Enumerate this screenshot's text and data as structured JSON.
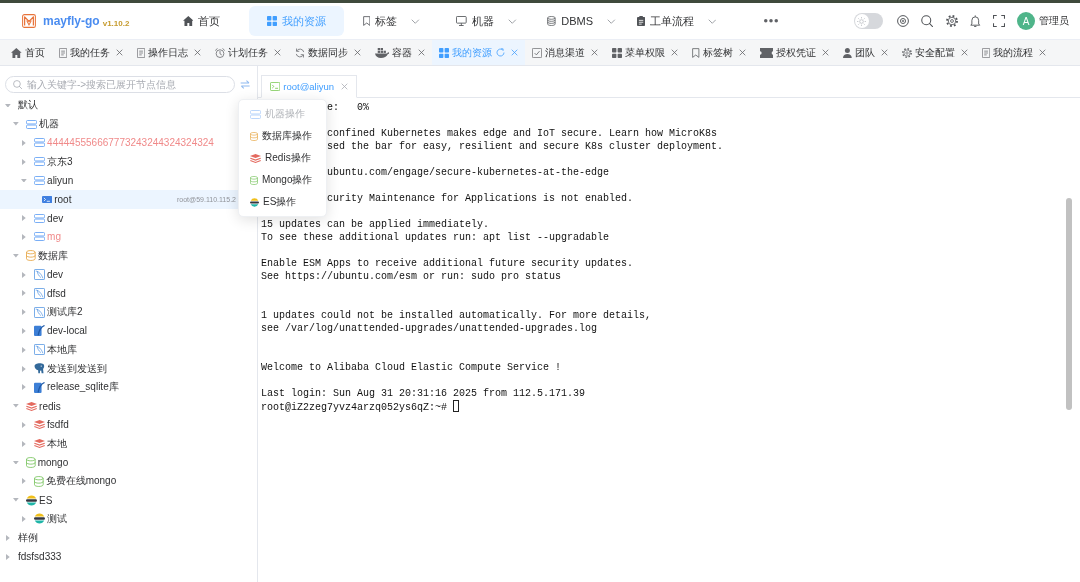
{
  "brand": {
    "name": "mayfly-go",
    "version": "v1.10.2"
  },
  "header": {
    "nav": [
      {
        "label": "首页",
        "selected": false,
        "dropdown": false
      },
      {
        "label": "我的资源",
        "selected": true,
        "dropdown": false
      },
      {
        "label": "标签",
        "selected": false,
        "dropdown": true
      },
      {
        "label": "机器",
        "selected": false,
        "dropdown": true
      },
      {
        "label": "DBMS",
        "selected": false,
        "dropdown": true
      },
      {
        "label": "工单流程",
        "selected": false,
        "dropdown": true
      }
    ],
    "theme_switch": {
      "on": false
    },
    "user": {
      "avatar": "A",
      "name": "管理员"
    }
  },
  "page_tabs": [
    {
      "label": "首页",
      "selected": false,
      "closable": false
    },
    {
      "label": "我的任务",
      "selected": false,
      "closable": true
    },
    {
      "label": "操作日志",
      "selected": false,
      "closable": true
    },
    {
      "label": "计划任务",
      "selected": false,
      "closable": true
    },
    {
      "label": "数据同步",
      "selected": false,
      "closable": true
    },
    {
      "label": "容器",
      "selected": false,
      "closable": true
    },
    {
      "label": "我的资源",
      "selected": true,
      "closable": true
    },
    {
      "label": "消息渠道",
      "selected": false,
      "closable": true
    },
    {
      "label": "菜单权限",
      "selected": false,
      "closable": true
    },
    {
      "label": "标签树",
      "selected": false,
      "closable": true
    },
    {
      "label": "授权凭证",
      "selected": false,
      "closable": true
    },
    {
      "label": "团队",
      "selected": false,
      "closable": true
    },
    {
      "label": "安全配置",
      "selected": false,
      "closable": true
    },
    {
      "label": "我的流程",
      "selected": false,
      "closable": true
    }
  ],
  "resource_tree": {
    "search": {
      "placeholder": "输入关键字->搜索已展开节点信息"
    },
    "nodes": [
      {
        "label": "默认",
        "expanded": true,
        "selected": false,
        "children": [
          {
            "label": "机器",
            "kind": "server",
            "expanded": true,
            "selected": false,
            "children": [
              {
                "label": "444445556667773243244324324324",
                "kind": "server",
                "expanded": false,
                "selected": false,
                "color": "#f08a8a"
              },
              {
                "label": "京东3",
                "kind": "server",
                "expanded": false,
                "selected": false
              },
              {
                "label": "aliyun",
                "kind": "server",
                "expanded": true,
                "selected": false,
                "children": [
                  {
                    "label": "root",
                    "kind": "account",
                    "selected": true,
                    "detail": "root@59.110.115.2"
                  }
                ]
              },
              {
                "label": "dev",
                "kind": "server",
                "expanded": false,
                "selected": false
              },
              {
                "label": "mg",
                "kind": "server",
                "expanded": false,
                "selected": false,
                "color": "#f08a8a"
              }
            ]
          },
          {
            "label": "数据库",
            "kind": "database",
            "expanded": true,
            "selected": false,
            "children": [
              {
                "label": "dev",
                "kind": "dbframe",
                "expanded": false,
                "selected": false
              },
              {
                "label": "dfsd",
                "kind": "dbframe",
                "expanded": false,
                "selected": false
              },
              {
                "label": "测试库2",
                "kind": "dbframe",
                "expanded": false,
                "selected": false
              },
              {
                "label": "dev-local",
                "kind": "dbfeather",
                "expanded": false,
                "selected": false
              },
              {
                "label": "本地库",
                "kind": "dbframe",
                "expanded": false,
                "selected": false
              },
              {
                "label": "发送到发送到",
                "kind": "dbelephant",
                "expanded": false,
                "selected": false
              },
              {
                "label": "release_sqlite库",
                "kind": "dbfeather",
                "expanded": false,
                "selected": false
              }
            ]
          },
          {
            "label": "redis",
            "kind": "redis",
            "expanded": true,
            "selected": false,
            "children": [
              {
                "label": "fsdfd",
                "kind": "redis",
                "expanded": false,
                "selected": false
              },
              {
                "label": "本地",
                "kind": "redis",
                "expanded": false,
                "selected": false
              }
            ]
          },
          {
            "label": "mongo",
            "kind": "mongo",
            "expanded": true,
            "selected": false,
            "children": [
              {
                "label": "免费在线mongo",
                "kind": "mongo",
                "expanded": false,
                "selected": false
              }
            ]
          },
          {
            "label": "ES",
            "kind": "es",
            "expanded": true,
            "selected": false,
            "children": [
              {
                "label": "测试",
                "kind": "es",
                "expanded": false,
                "selected": false
              }
            ]
          }
        ]
      },
      {
        "label": "样例",
        "expanded": false,
        "selected": false
      },
      {
        "label": "fdsfsd333",
        "expanded": false,
        "selected": false
      }
    ]
  },
  "context_menu": {
    "items": [
      {
        "kind": "server",
        "label": "机器操作",
        "disabled": true
      },
      {
        "kind": "database",
        "label": "数据库操作",
        "disabled": false
      },
      {
        "kind": "redis",
        "label": "Redis操作",
        "disabled": false
      },
      {
        "kind": "mongo",
        "label": "Mongo操作",
        "disabled": false
      },
      {
        "kind": "es",
        "label": "ES操作",
        "disabled": false
      }
    ]
  },
  "terminal": {
    "tabs": [
      {
        "label": "root@aliyun",
        "selected": true,
        "closable": true
      }
    ],
    "lines": [
      {
        "kind": "partial",
        "text": "e:   0%"
      },
      {
        "kind": "blank"
      },
      {
        "kind": "partial",
        "text": "confined Kubernetes makes edge and IoT secure. Learn how MicroK8s"
      },
      {
        "kind": "partial",
        "text": "sed the bar for easy, resilient and secure K8s cluster deployment."
      },
      {
        "kind": "blank"
      },
      {
        "kind": "partial",
        "text": "ubuntu.com/engage/secure-kubernetes-at-the-edge"
      },
      {
        "kind": "blank"
      },
      {
        "kind": "partial",
        "text": "curity Maintenance for Applications is not enabled."
      },
      {
        "kind": "blank"
      },
      {
        "kind": "text",
        "text": "15 updates can be applied immediately."
      },
      {
        "kind": "text",
        "text": "To see these additional updates run: apt list --upgradable"
      },
      {
        "kind": "blank"
      },
      {
        "kind": "text",
        "text": "Enable ESM Apps to receive additional future security updates."
      },
      {
        "kind": "text",
        "text": "See https://ubuntu.com/esm or run: sudo pro status"
      },
      {
        "kind": "blank"
      },
      {
        "kind": "blank"
      },
      {
        "kind": "text",
        "text": "1 updates could not be installed automatically. For more details,"
      },
      {
        "kind": "text",
        "text": "see /var/log/unattended-upgrades/unattended-upgrades.log"
      },
      {
        "kind": "blank"
      },
      {
        "kind": "blank"
      },
      {
        "kind": "text",
        "text": "Welcome to Alibaba Cloud Elastic Compute Service !"
      },
      {
        "kind": "blank"
      },
      {
        "kind": "text",
        "text": "Last login: Sun Aug 31 20:31:16 2025 from 112.5.171.39"
      },
      {
        "kind": "prompt",
        "text": "root@iZ2zeg7yvz4arzq052ys6qZ:~#"
      }
    ]
  }
}
